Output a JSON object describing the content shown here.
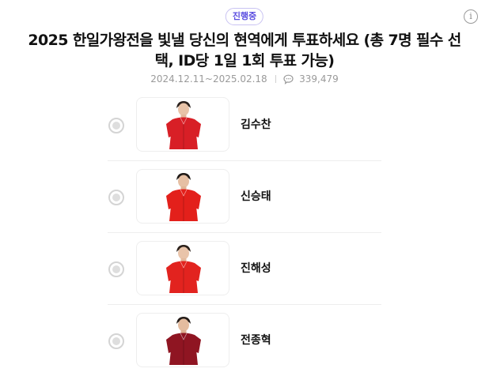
{
  "status_badge": "진행중",
  "title": "2025 한일가왕전을 빛낼 당신의 현역에게 투표하세요 (총 7명 필수 선택, ID당 1일 1회 투표 가능)",
  "period": "2024.12.11~2025.02.18",
  "comment_count": "339,479",
  "candidates": [
    {
      "name": "김수찬",
      "selected": false,
      "outfit_color": "#d81f26"
    },
    {
      "name": "신승태",
      "selected": false,
      "outfit_color": "#e3201b"
    },
    {
      "name": "진해성",
      "selected": false,
      "outfit_color": "#e2231f"
    },
    {
      "name": "전종혁",
      "selected": false,
      "outfit_color": "#8f1522"
    }
  ],
  "icons": {
    "info": "info-icon",
    "comment": "comment-bubble-icon",
    "radio": "radio-button-icon"
  },
  "colors": {
    "badge_text": "#5b4ee0",
    "badge_border": "#c9c3f2",
    "meta_text": "#9a9a9a"
  }
}
